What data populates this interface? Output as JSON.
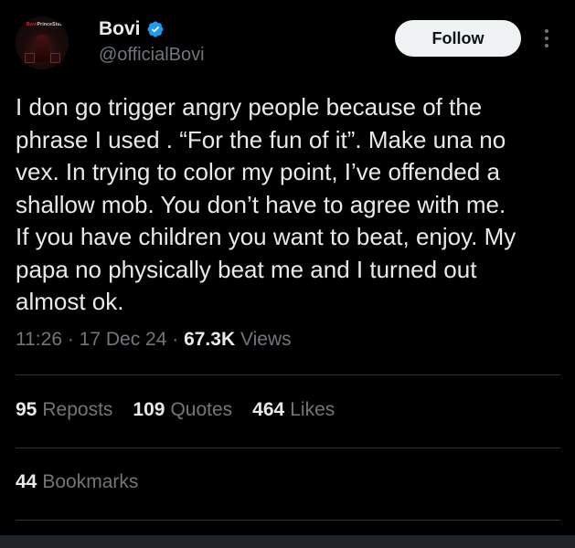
{
  "author": {
    "display_name": "Bovi",
    "handle": "@officialBovi",
    "verified": true,
    "avatar_text_red": "Bovi",
    "avatar_text_rest": "PrinceStudio"
  },
  "follow_button": {
    "label": "Follow"
  },
  "more_button": {
    "icon": "more-vertical-icon"
  },
  "tweet": {
    "lines": [
      "I don go trigger angry people because of the",
      "phrase I used . “For the fun of it”. Make una no",
      "vex. In trying to color my point, I’ve offended a",
      "shallow mob. You don’t have to agree with me.",
      "If you have children you want to beat, enjoy. My",
      "papa no physically beat me and I turned out",
      "almost ok."
    ]
  },
  "meta": {
    "time": "11:26",
    "separator": " · ",
    "date": "17 Dec 24",
    "views_count": "67.3K",
    "views_label": "Views"
  },
  "stats": {
    "reposts": {
      "count": "95",
      "label": "Reposts"
    },
    "quotes": {
      "count": "109",
      "label": "Quotes"
    },
    "likes": {
      "count": "464",
      "label": "Likes"
    },
    "bookmarks": {
      "count": "44",
      "label": "Bookmarks"
    }
  },
  "colors": {
    "background": "#000000",
    "text_primary": "#e7e9ea",
    "text_secondary": "#71767b",
    "divider": "#2f3336",
    "verified_blue": "#1d9bf0",
    "follow_bg": "#eff3f4"
  }
}
